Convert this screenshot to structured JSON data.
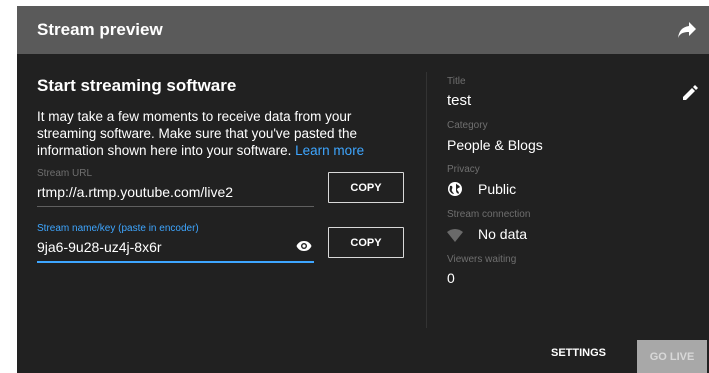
{
  "header": {
    "title": "Stream preview",
    "share_icon": "share-icon"
  },
  "left": {
    "title": "Start streaming software",
    "description": "It may take a few moments to receive data from your streaming software. Make sure that you've pasted the information shown here into your software.",
    "learn_more": "Learn more",
    "stream_url": {
      "label": "Stream URL",
      "value": "rtmp://a.rtmp.youtube.com/live2",
      "copy_label": "COPY"
    },
    "stream_key": {
      "label": "Stream name/key (paste in encoder)",
      "value": "9ja6-9u28-uz4j-8x6r",
      "copy_label": "COPY",
      "reveal_icon": "eye-icon"
    }
  },
  "right": {
    "title_label": "Title",
    "title_value": "test",
    "category_label": "Category",
    "category_value": "People & Blogs",
    "privacy_label": "Privacy",
    "privacy_value": "Public",
    "connection_label": "Stream connection",
    "connection_value": "No data",
    "viewers_label": "Viewers waiting",
    "viewers_value": "0",
    "edit_icon": "pencil-icon"
  },
  "footer": {
    "settings_label": "SETTINGS",
    "golive_label": "GO LIVE"
  },
  "colors": {
    "header_bg": "#5a5a5a",
    "panel_bg": "#212121",
    "accent": "#3ea6ff",
    "golive_bg": "#a8a8a8"
  }
}
